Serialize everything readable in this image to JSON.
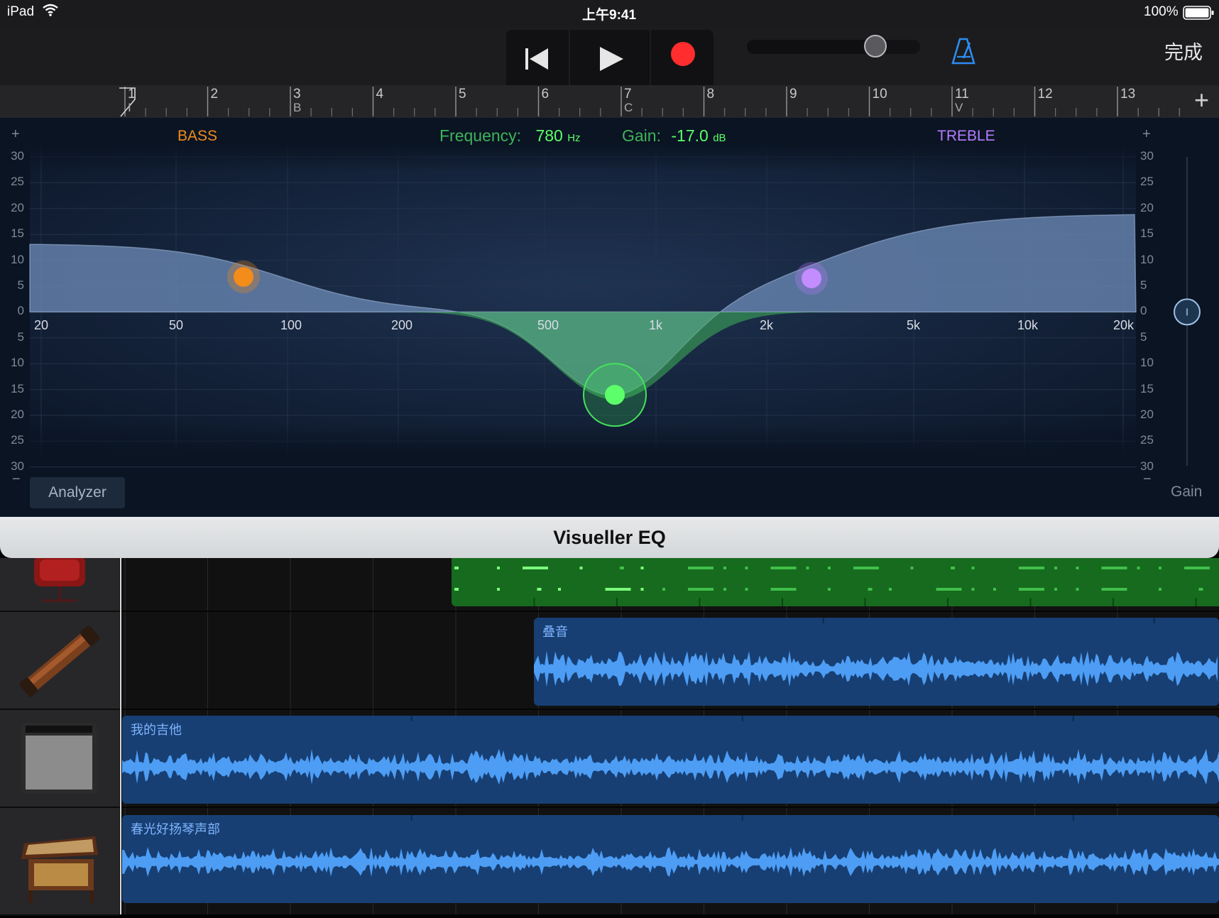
{
  "status": {
    "device": "iPad",
    "time": "上午9:41",
    "battery": "100%"
  },
  "toolbar": {
    "done_label": "完成",
    "volume_level": 0.78
  },
  "ruler": {
    "bars": [
      "1",
      "2",
      "3",
      "4",
      "5",
      "6",
      "7",
      "8",
      "9",
      "10",
      "11",
      "12",
      "13"
    ],
    "sections": [
      {
        "bar": "1",
        "label": "I"
      },
      {
        "bar": "3",
        "label": "B"
      },
      {
        "bar": "7",
        "label": "C"
      },
      {
        "bar": "11",
        "label": "V"
      }
    ],
    "add_label": "+"
  },
  "eq": {
    "bass_label": "BASS",
    "treble_label": "TREBLE",
    "frequency_label": "Frequency:",
    "frequency_value": "780",
    "frequency_unit": "Hz",
    "gain_label": "Gain:",
    "gain_value": "-17.0",
    "gain_unit": "dB",
    "y_ticks_top": [
      "30",
      "25",
      "20",
      "15",
      "10",
      "5",
      "0"
    ],
    "y_ticks_bottom": [
      "5",
      "10",
      "15",
      "20",
      "25",
      "30"
    ],
    "x_ticks": [
      "20",
      "50",
      "100",
      "200",
      "500",
      "1k",
      "2k",
      "5k",
      "10k",
      "20k"
    ],
    "plus_left": "+",
    "plus_right": "+",
    "minus_left": "−",
    "minus_right": "−",
    "analyzer_label": "Analyzer",
    "gain_slider_label": "Gain",
    "gain_slider_value_db": 0,
    "colors": {
      "bass": "#f28c1b",
      "mid": "#45e35a",
      "treble": "#b57cff",
      "curve_fill": "#6a88b4"
    }
  },
  "plugin_title": "Visueller EQ",
  "tracks": [
    {
      "name": "drum-track",
      "region_label": ""
    },
    {
      "name": "guzheng-track",
      "region_label": "叠音"
    },
    {
      "name": "guitar-track",
      "region_label": "我的吉他"
    },
    {
      "name": "yangqin-track",
      "region_label": "春光好扬琴声部"
    }
  ]
}
